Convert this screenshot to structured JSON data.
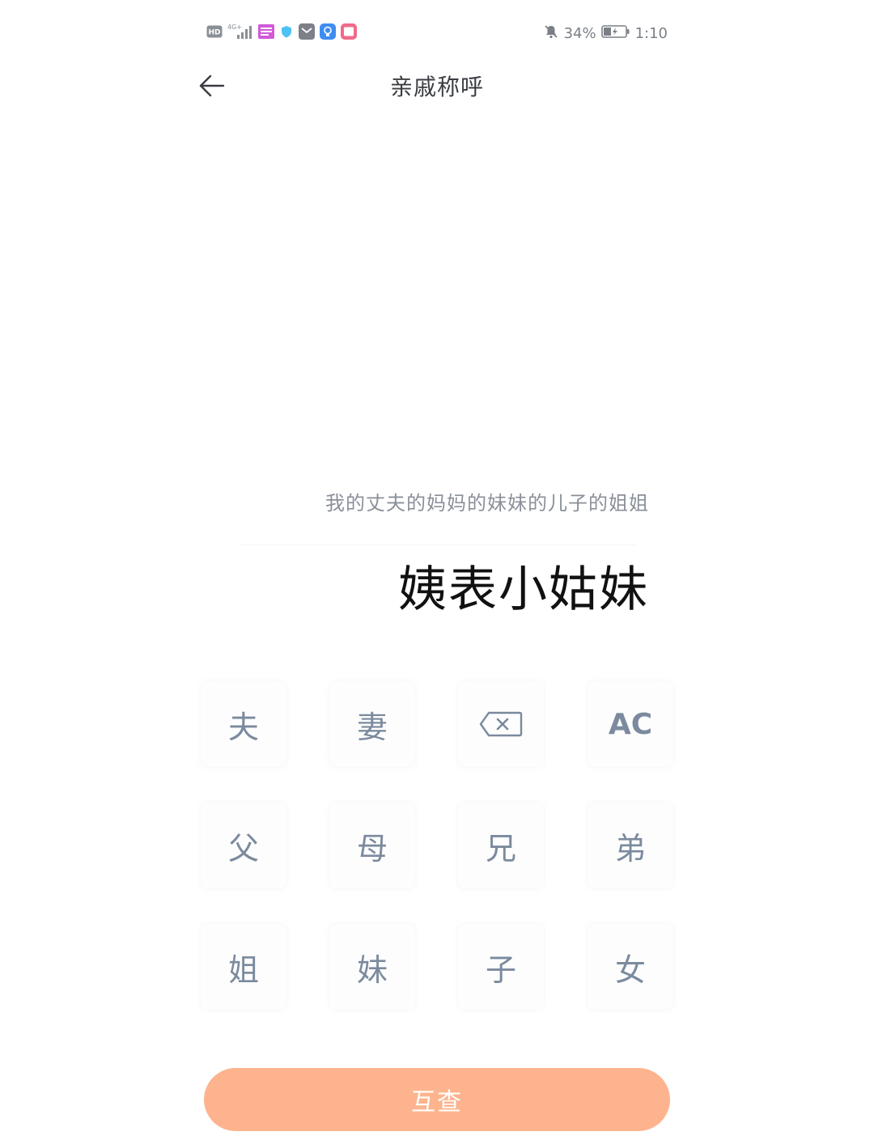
{
  "status_bar": {
    "hd_label": "HD",
    "network_label": "4G+",
    "battery_percent": "34%",
    "time": "1:10",
    "icons": [
      "hd-icon",
      "signal-icon",
      "app-notification-icon",
      "shield-icon",
      "mail-icon",
      "bulb-icon",
      "book-icon",
      "mute-icon",
      "battery-charging-icon"
    ]
  },
  "header": {
    "title": "亲戚称呼",
    "back_icon": "arrow-left-icon"
  },
  "display": {
    "expression": "我的丈夫的妈妈的妹妹的儿子的姐姐",
    "result": "姨表小姑妹"
  },
  "keypad": {
    "keys": [
      {
        "label": "夫"
      },
      {
        "label": "妻"
      },
      {
        "label": "",
        "icon": "backspace-icon"
      },
      {
        "label": "AC"
      },
      {
        "label": "父"
      },
      {
        "label": "母"
      },
      {
        "label": "兄"
      },
      {
        "label": "弟"
      },
      {
        "label": "姐"
      },
      {
        "label": "妹"
      },
      {
        "label": "子"
      },
      {
        "label": "女"
      }
    ]
  },
  "query_button": {
    "label": "互查"
  },
  "colors": {
    "accent": "#fdb48e",
    "key_text": "#7b8a9e",
    "title_text": "#3a3d42",
    "expression_text": "#8a9099",
    "result_text": "#111111"
  }
}
